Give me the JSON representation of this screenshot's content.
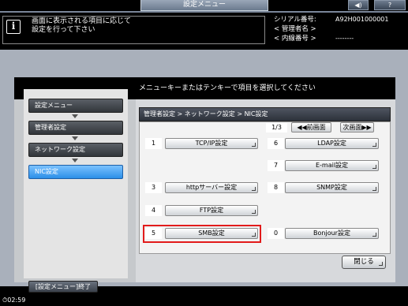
{
  "top": {
    "tab_title": "設定メニュー",
    "volume_icon": "◀)",
    "help_label": "?"
  },
  "header": {
    "info_icon": "i",
    "message_line1": "画面に表示される項目に応じて",
    "message_line2": "設定を行って下さい",
    "serial_label": "シリアル番号:",
    "serial_value": "A92H001000001",
    "admin_label": "< 管理者名 >",
    "ext_label": "< 内線番号 >",
    "ext_value": "--------"
  },
  "left_nav": {
    "items": [
      "設定メニュー",
      "管理者設定",
      "ネットワーク設定",
      "NIC設定"
    ],
    "end_button": "[設定メニュー]終了"
  },
  "main": {
    "instruction": "メニューキーまたはテンキーで項目を選択してください",
    "breadcrumb": "管理者設定 > ネットワーク設定 > NIC設定",
    "page": "1/3",
    "prev_label": "◀◀前画面",
    "next_label": "次画面▶▶",
    "items": [
      {
        "num": "1",
        "label": "TCP/IP設定"
      },
      {
        "num": "3",
        "label": "httpサーバー設定"
      },
      {
        "num": "4",
        "label": "FTP設定"
      },
      {
        "num": "5",
        "label": "SMB設定"
      },
      {
        "num": "6",
        "label": "LDAP設定"
      },
      {
        "num": "7",
        "label": "E-mail設定"
      },
      {
        "num": "8",
        "label": "SNMP設定"
      },
      {
        "num": "0",
        "label": "Bonjour設定"
      }
    ],
    "close_label": "閉じる"
  },
  "status": {
    "clock": "⏱02:59"
  },
  "colors": {
    "active_tab": "#2b8fe8",
    "highlight": "#e21b1b"
  }
}
